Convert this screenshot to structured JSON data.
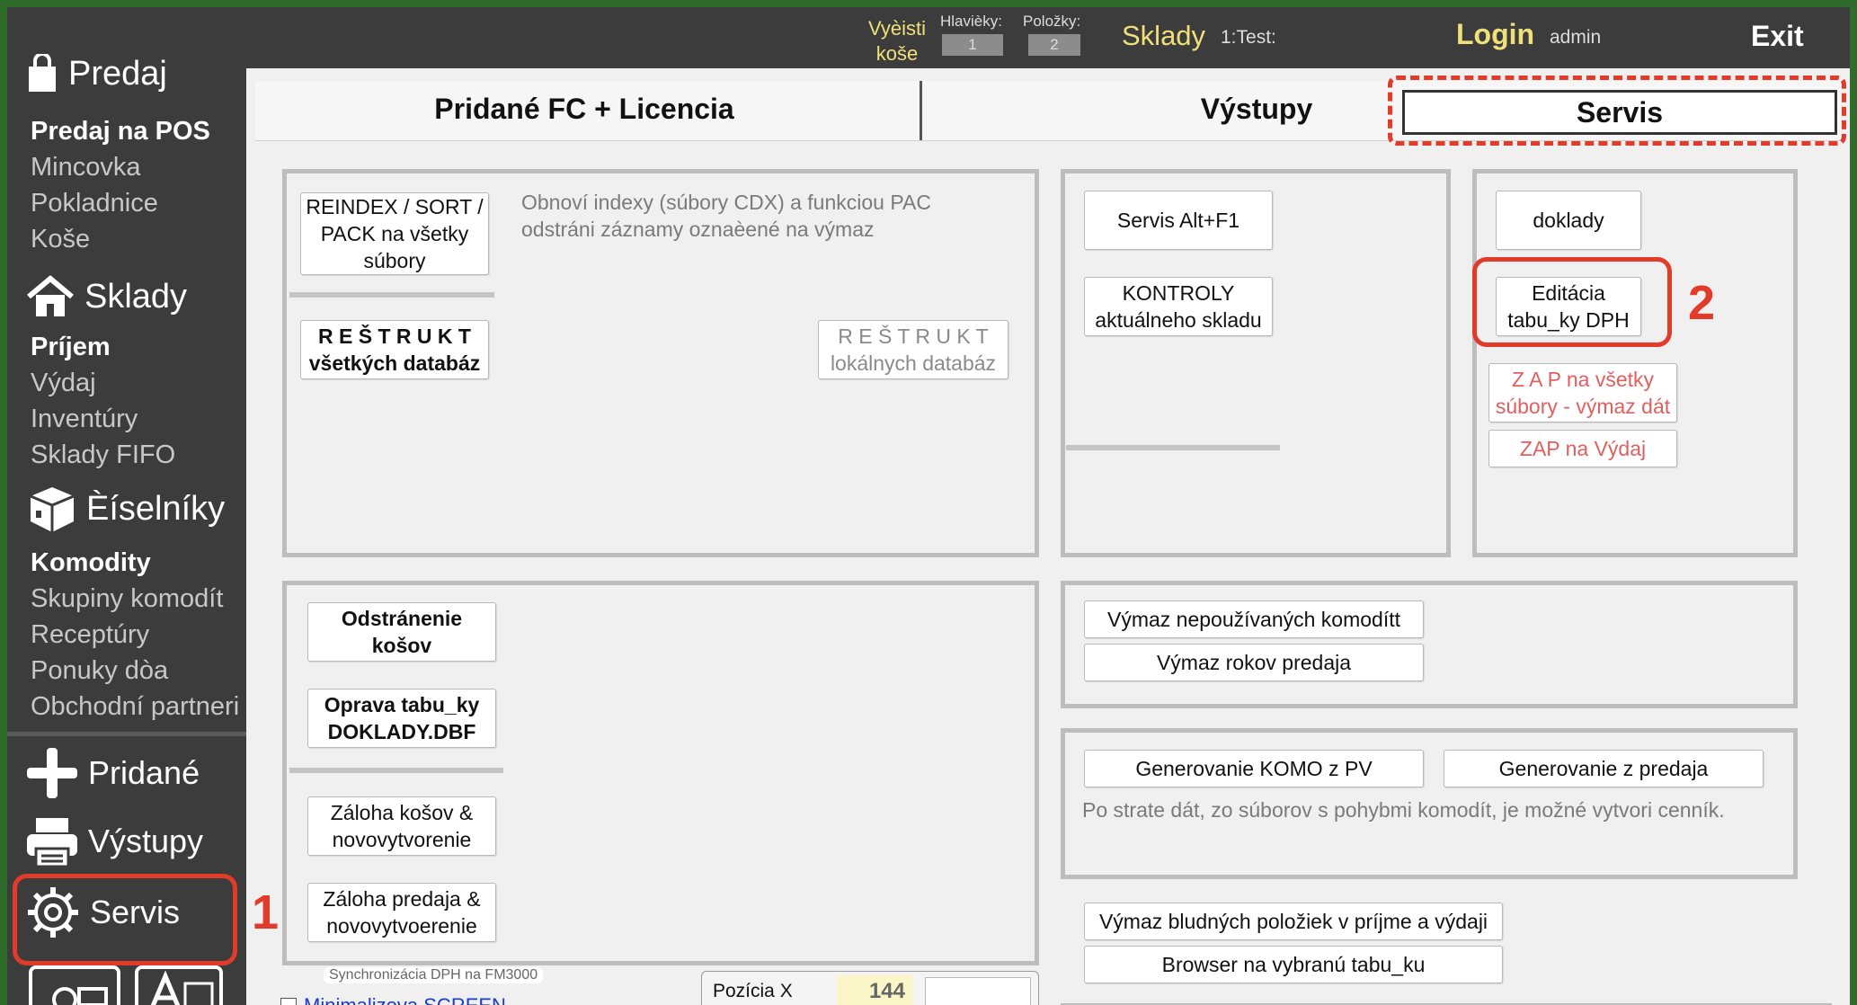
{
  "topbar": {
    "kose_label_1": "Vyèisti",
    "kose_label_2": "koše",
    "hlavicky_label": "Hlavièky:",
    "hlavicky_value": "1",
    "polozky_label": "Položky:",
    "polozky_value": "2",
    "module": "Sklady",
    "db": "1:Test:",
    "login": "Login",
    "user": "admin",
    "exit": "Exit"
  },
  "sidebar": {
    "predaj": {
      "title": "Predaj",
      "items": [
        "Predaj na POS",
        "Mincovka",
        "Pokladnice",
        "Koše"
      ]
    },
    "sklady": {
      "title": "Sklady",
      "items": [
        "Príjem",
        "Výdaj",
        "Inventúry",
        "Sklady FIFO"
      ]
    },
    "ciselniky": {
      "title": "Èíselníky",
      "items": [
        "Komodity",
        "Skupiny komodít",
        "Receptúry",
        "Ponuky dòa",
        "Obchodní partneri"
      ]
    },
    "bottom": {
      "pridane": "Pridané",
      "vystupy": "Výstupy",
      "servis": "Servis"
    }
  },
  "tabs": [
    "Pridané FC + Licencia",
    "Výstupy",
    "Servis"
  ],
  "panel1": {
    "reindex_1": "REINDEX / SORT /",
    "reindex_2": "PACK na všetky",
    "reindex_3": "súbory",
    "reindex_note_1": "Obnoví indexy (súbory CDX) a funkciou PAC",
    "reindex_note_2": "odstráni záznamy oznaèené na výmaz",
    "restrukt_all_1": "R E Š T R U K T",
    "restrukt_all_2": "všetkých databáz",
    "restrukt_local_1": "R E Š T R U K T",
    "restrukt_local_2": "lokálnych databáz"
  },
  "panel2": {
    "servis_alt": "Servis Alt+F1",
    "kontroly_1": "KONTROLY",
    "kontroly_2": "aktuálneho skladu"
  },
  "panel3": {
    "doklady": "doklady",
    "editacia_1": "Editácia",
    "editacia_2": "tabu_ky DPH",
    "zap_all_1": "Z A P   na všetky",
    "zap_all_2": "súbory - výmaz dát",
    "zap_vydaj": "ZAP na Výdaj"
  },
  "panel4": {
    "odstranenie_1": "Odstránenie",
    "odstranenie_2": "košov",
    "oprava_1": "Oprava tabu_ky",
    "oprava_2": "DOKLADY.DBF",
    "zaloha_kosov_1": "Záloha košov &",
    "zaloha_kosov_2": "novovytvorenie",
    "zaloha_predaja_1": "Záloha predaja &",
    "zaloha_predaja_2": "novovytvoerenie"
  },
  "panel5": {
    "vymaz_komodit": "Výmaz nepoužívaných komodítt",
    "vymaz_rokov": "Výmaz rokov predaja"
  },
  "panel6": {
    "gen_komo": "Generovanie KOMO z PV",
    "gen_predaj": "Generovanie z predaja",
    "note": "Po strate dát, zo súborov s pohybmi komodít, je možné vytvori cenník."
  },
  "bottom": {
    "vymaz_bludnych": "Výmaz bludných položiek v príjme a výdaji",
    "browser": "Browser na vybranú tabu_ku",
    "sync": "Synchronizácia DPH na FM3000",
    "minimalize": "Minimalizova SCREEN",
    "pozicia_x": "Pozícia X",
    "pozicia_x_value": "144"
  },
  "annotations": {
    "one": "1",
    "two": "2"
  },
  "colors": {
    "accent_red": "#e23b2a",
    "login_yellow": "#f0e07a",
    "sidebar_bg": "#3c3c3c",
    "frame_green": "#2f6b2a"
  }
}
